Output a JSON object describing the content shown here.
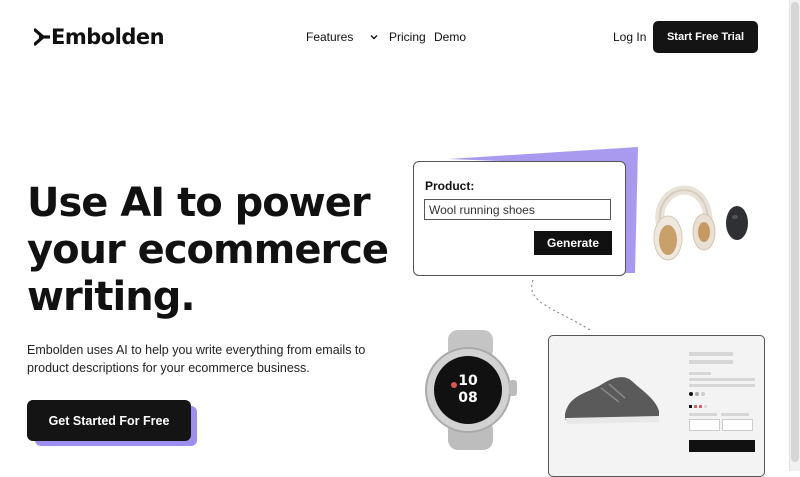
{
  "brand": {
    "name": "Embolden"
  },
  "nav": {
    "features": "Features",
    "pricing": "Pricing",
    "demo": "Demo"
  },
  "header": {
    "login": "Log In",
    "trial_button": "Start Free Trial"
  },
  "hero": {
    "title_lines": [
      "Use AI to power",
      "your ecommerce",
      "writing."
    ],
    "description": "Embolden uses AI to help you write everything from emails to product descriptions for your ecommerce business.",
    "cta": "Get Started For Free"
  },
  "demo_card": {
    "label": "Product:",
    "input_value": "Wool running shoes",
    "button": "Generate"
  },
  "colors": {
    "accent": "#9d8ff2",
    "dark": "#141414"
  }
}
